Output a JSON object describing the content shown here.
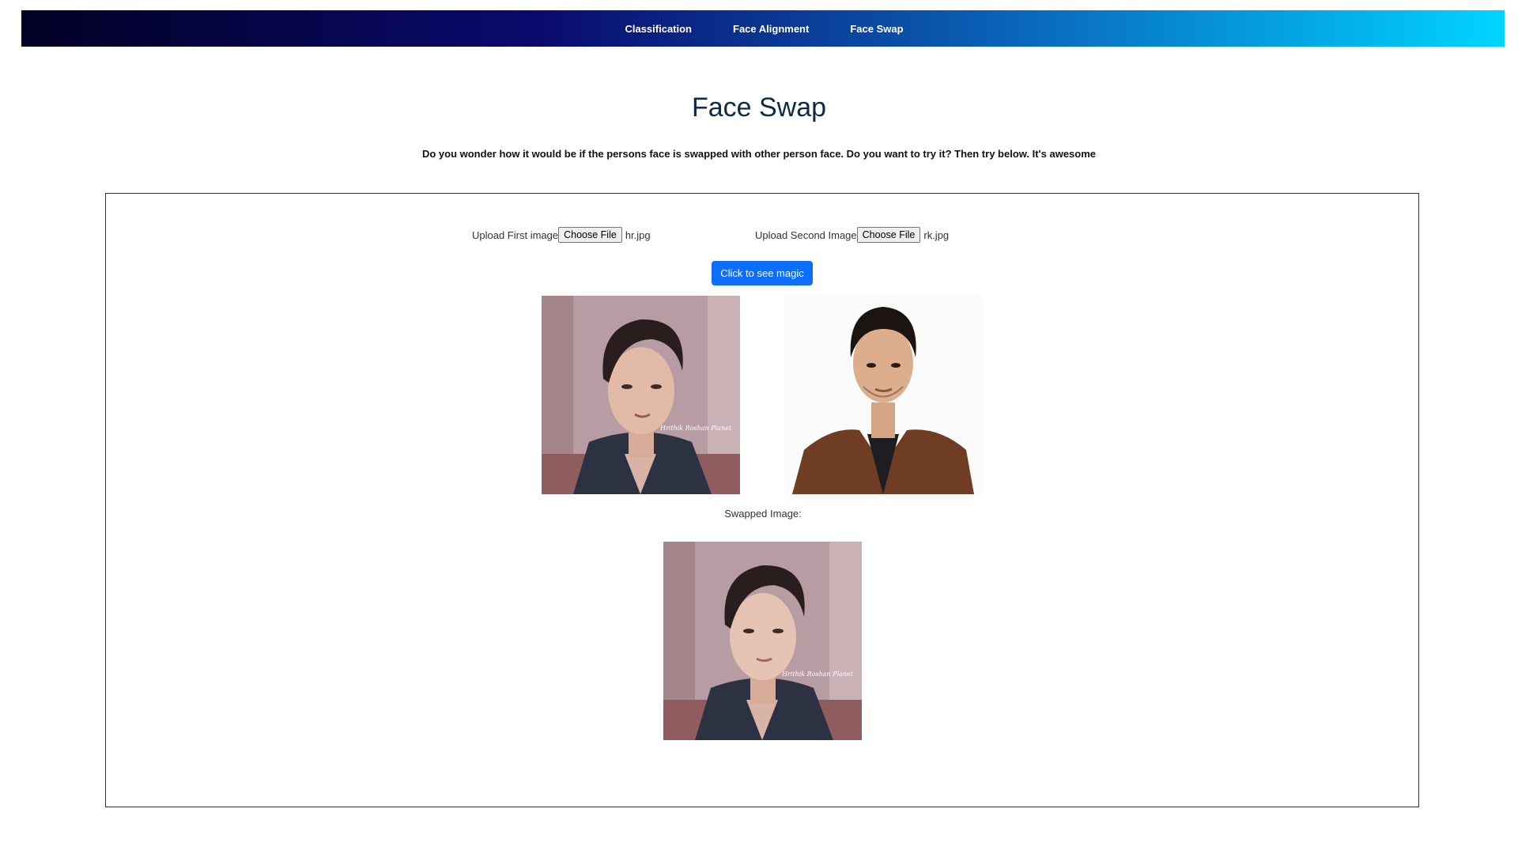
{
  "nav": {
    "items": [
      "Classification",
      "Face Alignment",
      "Face Swap"
    ]
  },
  "page": {
    "title": "Face Swap",
    "subtitle": "Do you wonder how it would be if the persons face is swapped with other person face. Do you want to try it? Then try below. It's awesome"
  },
  "uploads": [
    {
      "label": "Upload First image",
      "button": "Choose File",
      "filename": "hr.jpg"
    },
    {
      "label": "Upload Second Image",
      "button": "Choose File",
      "filename": "rk.jpg"
    }
  ],
  "action": {
    "button": "Click to see magic"
  },
  "result": {
    "label": "Swapped Image:"
  },
  "colors": {
    "nav_gradient_start": "#020024",
    "nav_gradient_mid": "#0a0a6e",
    "nav_gradient_end": "#00d4ff",
    "primary_button": "#0d6efd",
    "title": "#0d2b45"
  }
}
